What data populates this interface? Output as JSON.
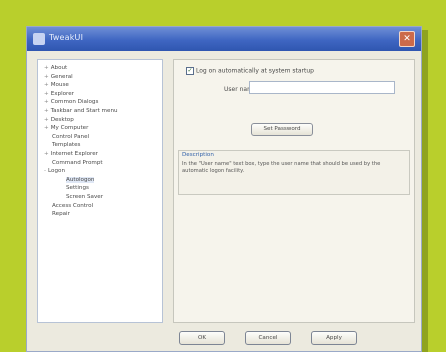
{
  "window": {
    "title": "TweakUI",
    "close_glyph": "✕"
  },
  "tree": {
    "items": [
      {
        "label": "About",
        "expander": "+",
        "level": 0
      },
      {
        "label": "General",
        "expander": "+",
        "level": 0
      },
      {
        "label": "Mouse",
        "expander": "+",
        "level": 0
      },
      {
        "label": "Explorer",
        "expander": "+",
        "level": 0
      },
      {
        "label": "Common Dialogs",
        "expander": "+",
        "level": 0
      },
      {
        "label": "Taskbar and Start menu",
        "expander": "+",
        "level": 0
      },
      {
        "label": "Desktop",
        "expander": "+",
        "level": 0
      },
      {
        "label": "My Computer",
        "expander": "+",
        "level": 0
      },
      {
        "label": "Control Panel",
        "expander": "",
        "level": 1
      },
      {
        "label": "Templates",
        "expander": "",
        "level": 1
      },
      {
        "label": "Internet Explorer",
        "expander": "+",
        "level": 0
      },
      {
        "label": "Command Prompt",
        "expander": "",
        "level": 1
      },
      {
        "label": "Logon",
        "expander": "-",
        "level": 0
      },
      {
        "label": "Autologon",
        "expander": "",
        "level": 2,
        "selected": true
      },
      {
        "label": "Settings",
        "expander": "",
        "level": 2
      },
      {
        "label": "Screen Saver",
        "expander": "",
        "level": 2
      },
      {
        "label": "Access Control",
        "expander": "",
        "level": 1
      },
      {
        "label": "Repair",
        "expander": "",
        "level": 1
      }
    ]
  },
  "panel": {
    "autologon_checkbox_label": "Log on automatically at system startup",
    "autologon_checked": true,
    "check_glyph": "✓",
    "user_name_label": "User name:",
    "user_name_value": "",
    "set_password_label": "Set Password"
  },
  "description": {
    "title": "Description",
    "text": "In the \"User name\" text box, type the user name that should be used by the automatic logon facility."
  },
  "footer": {
    "ok_label": "OK",
    "cancel_label": "Cancel",
    "apply_label": "Apply"
  },
  "colors": {
    "background": "#b9cf2c",
    "titlebar": "#3f66c2",
    "window": "#eceadf"
  }
}
